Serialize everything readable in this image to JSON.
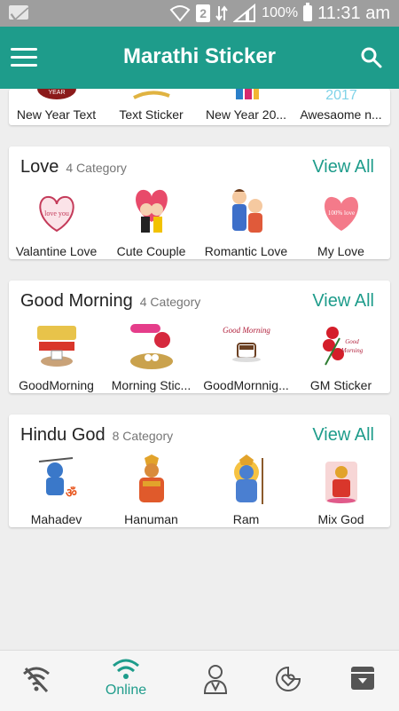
{
  "status_bar": {
    "battery": "100%",
    "time": "11:31 am",
    "sim": "2"
  },
  "app_bar": {
    "title": "Marathi Sticker"
  },
  "top_strip": {
    "items": [
      "New Year Text",
      "Text Sticker",
      "New Year 20...",
      "Awesaome n..."
    ]
  },
  "sections": [
    {
      "title": "Love",
      "count": "4 Category",
      "view_all": "View All",
      "items": [
        "Valantine Love",
        "Cute Couple",
        "Romantic Love",
        "My Love"
      ]
    },
    {
      "title": "Good Morning",
      "count": "4 Category",
      "view_all": "View All",
      "items": [
        "GoodMorning",
        "Morning Stic...",
        "GoodMornnig...",
        "GM Sticker"
      ]
    },
    {
      "title": "Hindu God",
      "count": "8 Category",
      "view_all": "View All",
      "items": [
        "Mahadev",
        "Hanuman",
        "Ram",
        "Mix God"
      ]
    }
  ],
  "bottom_nav": {
    "online_label": "Online",
    "icons": [
      "wifi-off-icon",
      "wifi-icon",
      "user-icon",
      "sticker-heart-icon",
      "archive-icon"
    ]
  },
  "colors": {
    "primary": "#1e9c8b",
    "status_bar": "#9e9e9e",
    "background": "#eeeeee"
  }
}
